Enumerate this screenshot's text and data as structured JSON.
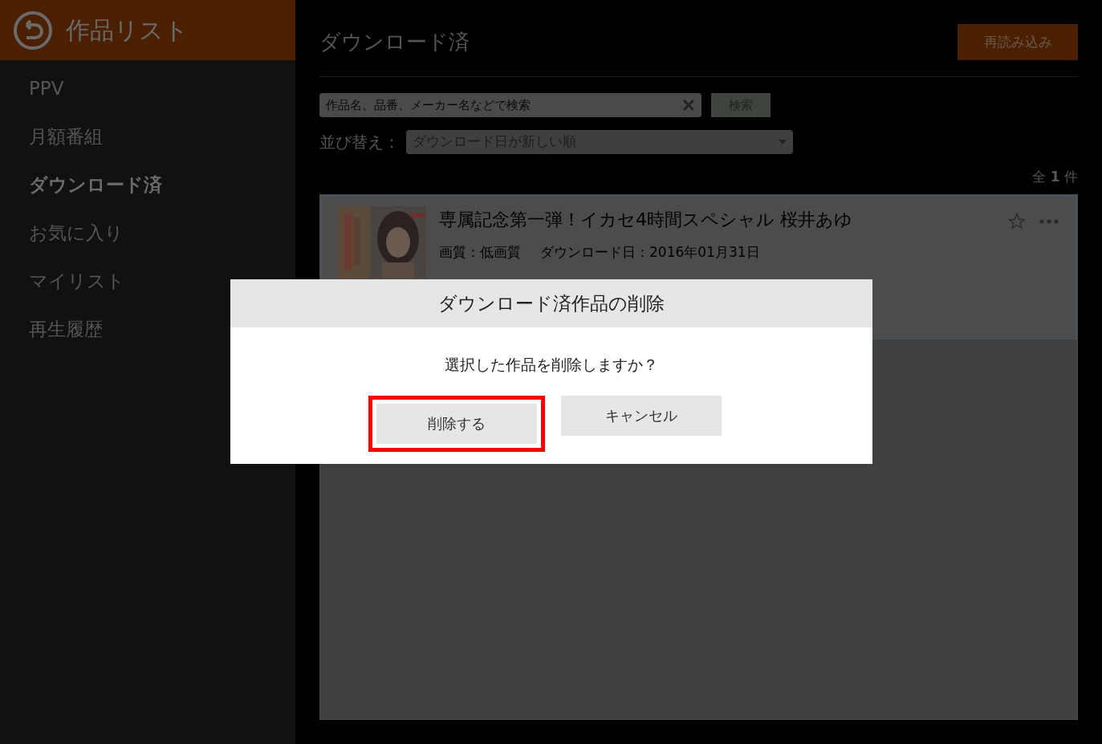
{
  "header": {
    "title": "作品リスト"
  },
  "sidebar": {
    "items": [
      {
        "label": "PPV",
        "selected": false
      },
      {
        "label": "月額番組",
        "selected": false
      },
      {
        "label": "ダウンロード済",
        "selected": true
      },
      {
        "label": "お気に入り",
        "selected": false
      },
      {
        "label": "マイリスト",
        "selected": false
      },
      {
        "label": "再生履歴",
        "selected": false
      }
    ]
  },
  "main": {
    "title": "ダウンロード済",
    "reload_button": "再読み込み",
    "search": {
      "placeholder": "作品名、品番、メーカー名などで検索",
      "button": "検索"
    },
    "sort": {
      "label": "並び替え：",
      "value": "ダウンロード日が新しい順"
    },
    "count": "全 **1** 件",
    "items": [
      {
        "title": "専属記念第一弾！イカセ4時間スペシャル 桜井あゆ",
        "quality": "画質：低画質",
        "date": "ダウンロード日：2016年01月31日"
      }
    ]
  },
  "dialog": {
    "title": "ダウンロード済作品の削除",
    "message": "選択した作品を削除しますか？",
    "buttons": [
      {
        "label": "削除する",
        "highlighted": true
      },
      {
        "label": "キャンセル",
        "highlighted": false
      }
    ]
  }
}
